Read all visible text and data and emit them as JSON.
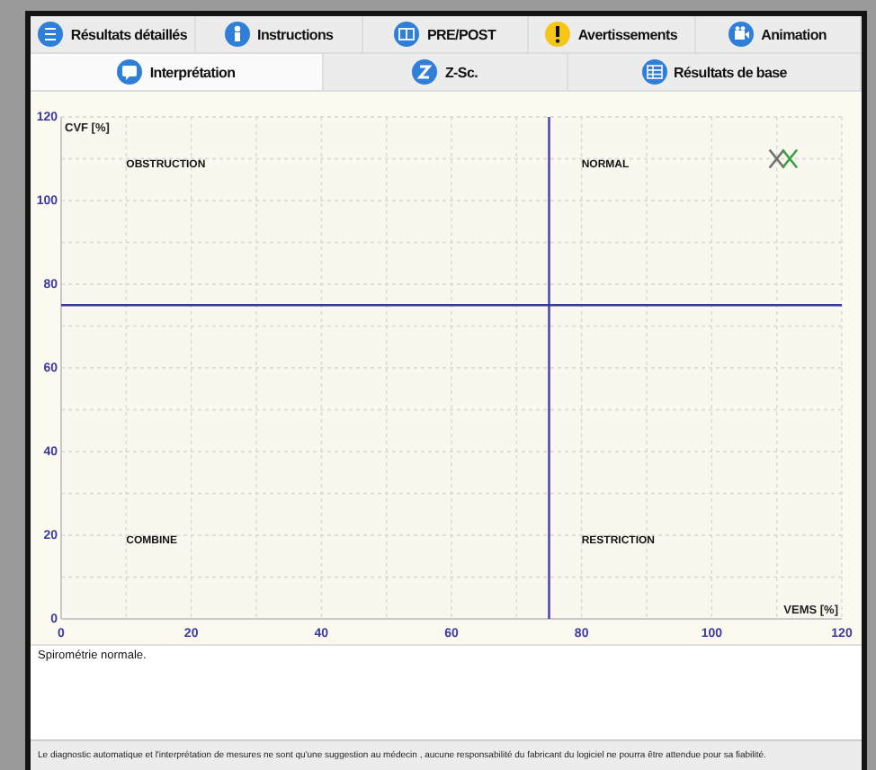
{
  "tabs_top": [
    {
      "label": "Résultats détaillés",
      "selected": false
    },
    {
      "label": "Instructions",
      "selected": false
    },
    {
      "label": "PRE/POST",
      "selected": false
    },
    {
      "label": "Avertissements",
      "selected": false
    },
    {
      "label": "Animation",
      "selected": false
    }
  ],
  "tabs_bottom": [
    {
      "label": "Interprétation",
      "selected": true
    },
    {
      "label": "Z-Sc.",
      "selected": false
    },
    {
      "label": "Résultats de base",
      "selected": false
    }
  ],
  "chart": {
    "chart_data": {
      "type": "scatter",
      "xlabel": "VEMS [%]",
      "ylabel": "CVF [%]",
      "xlim": [
        0,
        120
      ],
      "ylim": [
        0,
        120
      ],
      "grid": true,
      "xticks": [
        0,
        20,
        40,
        60,
        80,
        100,
        120
      ],
      "yticks": [
        0,
        20,
        40,
        60,
        80,
        100,
        120
      ],
      "x": [
        110,
        112
      ],
      "series": [
        {
          "color": "#707070",
          "values": [
            110,
            null
          ]
        },
        {
          "color": "#3aa044",
          "values": [
            null,
            110
          ]
        }
      ],
      "ref_lines": [
        {
          "axis": "x",
          "value": 75
        },
        {
          "axis": "y",
          "value": 75
        }
      ],
      "annotations": [
        "OBSTRUCTION",
        "NORMAL",
        "COMBINE",
        "RESTRICTION"
      ]
    }
  },
  "interpretation": "Spirométrie normale.",
  "disclaimer": "Le diagnostic automatique et l'interprétation de mesures ne sont qu'une suggestion au médecin , aucune responsabilité du fabricant du logiciel ne pourra être attendue pour sa fiabilité."
}
